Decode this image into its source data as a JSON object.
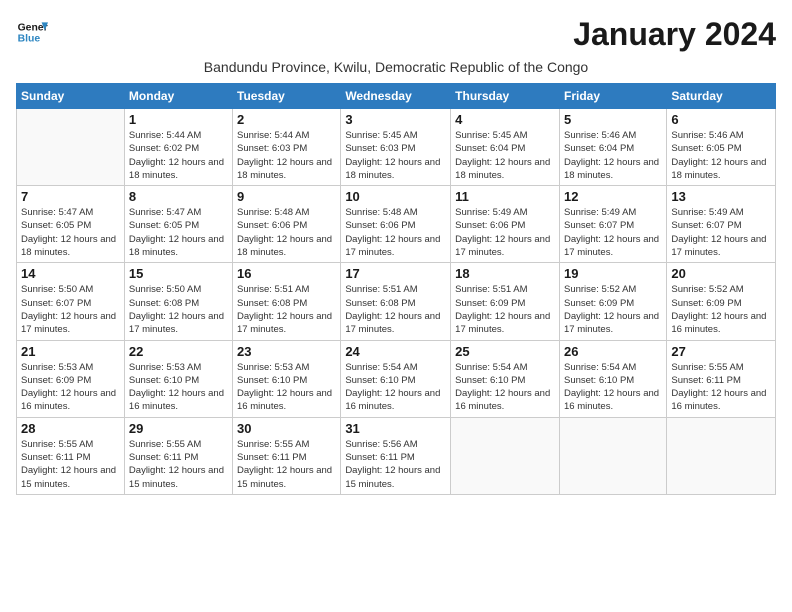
{
  "header": {
    "logo_line1": "General",
    "logo_line2": "Blue",
    "month": "January 2024",
    "subtitle": "Bandundu Province, Kwilu, Democratic Republic of the Congo"
  },
  "days_of_week": [
    "Sunday",
    "Monday",
    "Tuesday",
    "Wednesday",
    "Thursday",
    "Friday",
    "Saturday"
  ],
  "weeks": [
    [
      {
        "day": "",
        "sunrise": "",
        "sunset": "",
        "daylight": ""
      },
      {
        "day": "1",
        "sunrise": "Sunrise: 5:44 AM",
        "sunset": "Sunset: 6:02 PM",
        "daylight": "Daylight: 12 hours and 18 minutes."
      },
      {
        "day": "2",
        "sunrise": "Sunrise: 5:44 AM",
        "sunset": "Sunset: 6:03 PM",
        "daylight": "Daylight: 12 hours and 18 minutes."
      },
      {
        "day": "3",
        "sunrise": "Sunrise: 5:45 AM",
        "sunset": "Sunset: 6:03 PM",
        "daylight": "Daylight: 12 hours and 18 minutes."
      },
      {
        "day": "4",
        "sunrise": "Sunrise: 5:45 AM",
        "sunset": "Sunset: 6:04 PM",
        "daylight": "Daylight: 12 hours and 18 minutes."
      },
      {
        "day": "5",
        "sunrise": "Sunrise: 5:46 AM",
        "sunset": "Sunset: 6:04 PM",
        "daylight": "Daylight: 12 hours and 18 minutes."
      },
      {
        "day": "6",
        "sunrise": "Sunrise: 5:46 AM",
        "sunset": "Sunset: 6:05 PM",
        "daylight": "Daylight: 12 hours and 18 minutes."
      }
    ],
    [
      {
        "day": "7",
        "sunrise": "Sunrise: 5:47 AM",
        "sunset": "Sunset: 6:05 PM",
        "daylight": "Daylight: 12 hours and 18 minutes."
      },
      {
        "day": "8",
        "sunrise": "Sunrise: 5:47 AM",
        "sunset": "Sunset: 6:05 PM",
        "daylight": "Daylight: 12 hours and 18 minutes."
      },
      {
        "day": "9",
        "sunrise": "Sunrise: 5:48 AM",
        "sunset": "Sunset: 6:06 PM",
        "daylight": "Daylight: 12 hours and 18 minutes."
      },
      {
        "day": "10",
        "sunrise": "Sunrise: 5:48 AM",
        "sunset": "Sunset: 6:06 PM",
        "daylight": "Daylight: 12 hours and 17 minutes."
      },
      {
        "day": "11",
        "sunrise": "Sunrise: 5:49 AM",
        "sunset": "Sunset: 6:06 PM",
        "daylight": "Daylight: 12 hours and 17 minutes."
      },
      {
        "day": "12",
        "sunrise": "Sunrise: 5:49 AM",
        "sunset": "Sunset: 6:07 PM",
        "daylight": "Daylight: 12 hours and 17 minutes."
      },
      {
        "day": "13",
        "sunrise": "Sunrise: 5:49 AM",
        "sunset": "Sunset: 6:07 PM",
        "daylight": "Daylight: 12 hours and 17 minutes."
      }
    ],
    [
      {
        "day": "14",
        "sunrise": "Sunrise: 5:50 AM",
        "sunset": "Sunset: 6:07 PM",
        "daylight": "Daylight: 12 hours and 17 minutes."
      },
      {
        "day": "15",
        "sunrise": "Sunrise: 5:50 AM",
        "sunset": "Sunset: 6:08 PM",
        "daylight": "Daylight: 12 hours and 17 minutes."
      },
      {
        "day": "16",
        "sunrise": "Sunrise: 5:51 AM",
        "sunset": "Sunset: 6:08 PM",
        "daylight": "Daylight: 12 hours and 17 minutes."
      },
      {
        "day": "17",
        "sunrise": "Sunrise: 5:51 AM",
        "sunset": "Sunset: 6:08 PM",
        "daylight": "Daylight: 12 hours and 17 minutes."
      },
      {
        "day": "18",
        "sunrise": "Sunrise: 5:51 AM",
        "sunset": "Sunset: 6:09 PM",
        "daylight": "Daylight: 12 hours and 17 minutes."
      },
      {
        "day": "19",
        "sunrise": "Sunrise: 5:52 AM",
        "sunset": "Sunset: 6:09 PM",
        "daylight": "Daylight: 12 hours and 17 minutes."
      },
      {
        "day": "20",
        "sunrise": "Sunrise: 5:52 AM",
        "sunset": "Sunset: 6:09 PM",
        "daylight": "Daylight: 12 hours and 16 minutes."
      }
    ],
    [
      {
        "day": "21",
        "sunrise": "Sunrise: 5:53 AM",
        "sunset": "Sunset: 6:09 PM",
        "daylight": "Daylight: 12 hours and 16 minutes."
      },
      {
        "day": "22",
        "sunrise": "Sunrise: 5:53 AM",
        "sunset": "Sunset: 6:10 PM",
        "daylight": "Daylight: 12 hours and 16 minutes."
      },
      {
        "day": "23",
        "sunrise": "Sunrise: 5:53 AM",
        "sunset": "Sunset: 6:10 PM",
        "daylight": "Daylight: 12 hours and 16 minutes."
      },
      {
        "day": "24",
        "sunrise": "Sunrise: 5:54 AM",
        "sunset": "Sunset: 6:10 PM",
        "daylight": "Daylight: 12 hours and 16 minutes."
      },
      {
        "day": "25",
        "sunrise": "Sunrise: 5:54 AM",
        "sunset": "Sunset: 6:10 PM",
        "daylight": "Daylight: 12 hours and 16 minutes."
      },
      {
        "day": "26",
        "sunrise": "Sunrise: 5:54 AM",
        "sunset": "Sunset: 6:10 PM",
        "daylight": "Daylight: 12 hours and 16 minutes."
      },
      {
        "day": "27",
        "sunrise": "Sunrise: 5:55 AM",
        "sunset": "Sunset: 6:11 PM",
        "daylight": "Daylight: 12 hours and 16 minutes."
      }
    ],
    [
      {
        "day": "28",
        "sunrise": "Sunrise: 5:55 AM",
        "sunset": "Sunset: 6:11 PM",
        "daylight": "Daylight: 12 hours and 15 minutes."
      },
      {
        "day": "29",
        "sunrise": "Sunrise: 5:55 AM",
        "sunset": "Sunset: 6:11 PM",
        "daylight": "Daylight: 12 hours and 15 minutes."
      },
      {
        "day": "30",
        "sunrise": "Sunrise: 5:55 AM",
        "sunset": "Sunset: 6:11 PM",
        "daylight": "Daylight: 12 hours and 15 minutes."
      },
      {
        "day": "31",
        "sunrise": "Sunrise: 5:56 AM",
        "sunset": "Sunset: 6:11 PM",
        "daylight": "Daylight: 12 hours and 15 minutes."
      },
      {
        "day": "",
        "sunrise": "",
        "sunset": "",
        "daylight": ""
      },
      {
        "day": "",
        "sunrise": "",
        "sunset": "",
        "daylight": ""
      },
      {
        "day": "",
        "sunrise": "",
        "sunset": "",
        "daylight": ""
      }
    ]
  ]
}
